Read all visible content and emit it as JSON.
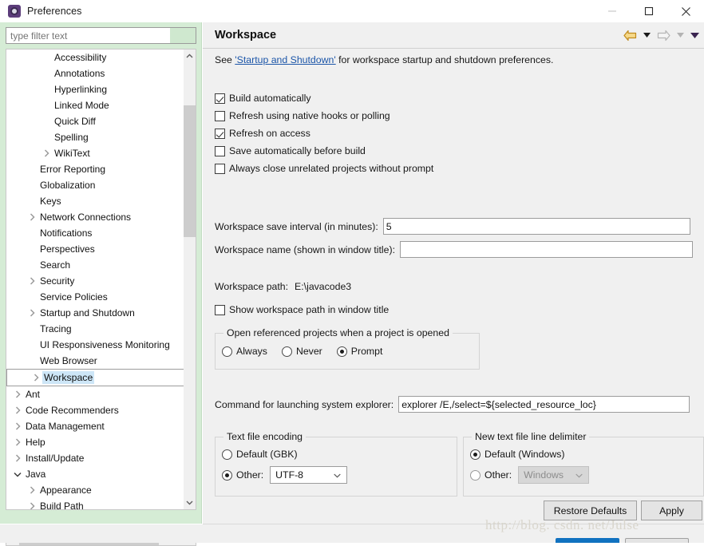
{
  "window": {
    "title": "Preferences",
    "icon": "preferences-gear-icon",
    "minimize_label": "—",
    "maximize_label": "□",
    "close_label": "✕"
  },
  "sidebar": {
    "filter": {
      "placeholder": "type filter text",
      "value": ""
    },
    "tree": [
      {
        "label": "Accessibility",
        "indent": 3,
        "expandable": false,
        "selected": false
      },
      {
        "label": "Annotations",
        "indent": 3,
        "expandable": false,
        "selected": false
      },
      {
        "label": "Hyperlinking",
        "indent": 3,
        "expandable": false,
        "selected": false
      },
      {
        "label": "Linked Mode",
        "indent": 3,
        "expandable": false,
        "selected": false
      },
      {
        "label": "Quick Diff",
        "indent": 3,
        "expandable": false,
        "selected": false
      },
      {
        "label": "Spelling",
        "indent": 3,
        "expandable": false,
        "selected": false
      },
      {
        "label": "WikiText",
        "indent": 3,
        "expandable": true,
        "expanded": false,
        "selected": false
      },
      {
        "label": "Error Reporting",
        "indent": 2,
        "expandable": false,
        "selected": false
      },
      {
        "label": "Globalization",
        "indent": 2,
        "expandable": false,
        "selected": false
      },
      {
        "label": "Keys",
        "indent": 2,
        "expandable": false,
        "selected": false
      },
      {
        "label": "Network Connections",
        "indent": 2,
        "expandable": true,
        "expanded": false,
        "selected": false
      },
      {
        "label": "Notifications",
        "indent": 2,
        "expandable": false,
        "selected": false
      },
      {
        "label": "Perspectives",
        "indent": 2,
        "expandable": false,
        "selected": false
      },
      {
        "label": "Search",
        "indent": 2,
        "expandable": false,
        "selected": false
      },
      {
        "label": "Security",
        "indent": 2,
        "expandable": true,
        "expanded": false,
        "selected": false
      },
      {
        "label": "Service Policies",
        "indent": 2,
        "expandable": false,
        "selected": false
      },
      {
        "label": "Startup and Shutdown",
        "indent": 2,
        "expandable": true,
        "expanded": false,
        "selected": false
      },
      {
        "label": "Tracing",
        "indent": 2,
        "expandable": false,
        "selected": false
      },
      {
        "label": "UI Responsiveness Monitoring",
        "indent": 2,
        "expandable": false,
        "selected": false
      },
      {
        "label": "Web Browser",
        "indent": 2,
        "expandable": false,
        "selected": false
      },
      {
        "label": "Workspace",
        "indent": 2,
        "expandable": true,
        "expanded": false,
        "selected": true
      },
      {
        "label": "Ant",
        "indent": 1,
        "expandable": true,
        "expanded": false,
        "selected": false
      },
      {
        "label": "Code Recommenders",
        "indent": 1,
        "expandable": true,
        "expanded": false,
        "selected": false
      },
      {
        "label": "Data Management",
        "indent": 1,
        "expandable": true,
        "expanded": false,
        "selected": false
      },
      {
        "label": "Help",
        "indent": 1,
        "expandable": true,
        "expanded": false,
        "selected": false
      },
      {
        "label": "Install/Update",
        "indent": 1,
        "expandable": true,
        "expanded": false,
        "selected": false
      },
      {
        "label": "Java",
        "indent": 1,
        "expandable": true,
        "expanded": true,
        "selected": false
      },
      {
        "label": "Appearance",
        "indent": 2,
        "expandable": true,
        "expanded": false,
        "selected": false
      },
      {
        "label": "Build Path",
        "indent": 2,
        "expandable": true,
        "expanded": false,
        "selected": false
      }
    ]
  },
  "page": {
    "title": "Workspace",
    "nav": {
      "back_icon": "back-arrow-icon",
      "back_menu_icon": "chevron-down-icon",
      "forward_icon": "forward-arrow-icon",
      "forward_menu_icon": "chevron-down-icon",
      "view_menu_icon": "chevron-down-icon"
    },
    "description": {
      "prefix": "See ",
      "link": "'Startup and Shutdown'",
      "suffix": " for workspace startup and shutdown preferences."
    },
    "checkboxes": [
      {
        "label": "Build automatically",
        "checked": true
      },
      {
        "label": "Refresh using native hooks or polling",
        "checked": false
      },
      {
        "label": "Refresh on access",
        "checked": true
      },
      {
        "label": "Save automatically before build",
        "checked": false
      },
      {
        "label": "Always close unrelated projects without prompt",
        "checked": false
      }
    ],
    "save_interval": {
      "label": "Workspace save interval (in minutes):",
      "value": "5"
    },
    "workspace_name": {
      "label": "Workspace name (shown in window title):",
      "value": "",
      "placeholder": ""
    },
    "workspace_path": {
      "label": "Workspace path:",
      "value": "E:\\javacode3"
    },
    "show_path_checkbox": {
      "label": "Show workspace path in window title",
      "checked": false
    },
    "referenced_projects": {
      "legend": "Open referenced projects when a project is opened",
      "options": [
        {
          "label": "Always",
          "selected": false
        },
        {
          "label": "Never",
          "selected": false
        },
        {
          "label": "Prompt",
          "selected": true
        }
      ]
    },
    "explorer_command": {
      "label": "Command for launching system explorer:",
      "value": "explorer /E,/select=${selected_resource_loc}"
    },
    "text_file_encoding": {
      "legend": "Text file encoding",
      "default_option": {
        "label": "Default (GBK)",
        "selected": false
      },
      "other_option": {
        "label": "Other:",
        "selected": true
      },
      "other_value": "UTF-8",
      "caret_icon": "chevron-down-icon"
    },
    "line_delimiter": {
      "legend": "New text file line delimiter",
      "default_option": {
        "label": "Default (Windows)",
        "selected": true
      },
      "other_option": {
        "label": "Other:",
        "selected": false
      },
      "other_value": "Windows",
      "other_disabled": true,
      "caret_icon": "chevron-down-icon"
    },
    "buttons": {
      "restore_defaults": "Restore Defaults",
      "apply": "Apply"
    }
  },
  "watermark": "http://blog. csdn. net/Julse"
}
